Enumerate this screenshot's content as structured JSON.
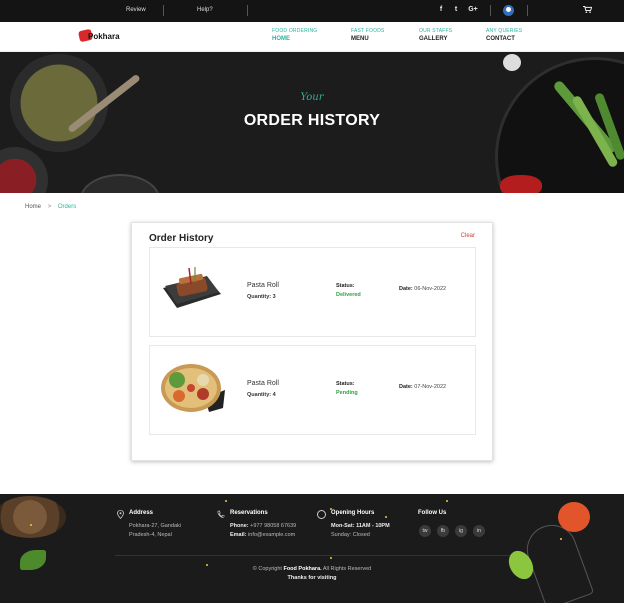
{
  "topbar": {
    "review_label": "Review",
    "help_label": "Help?",
    "social": [
      "f",
      "t",
      "G+"
    ]
  },
  "logo": {
    "text": "Pokhara",
    "badge": "Food"
  },
  "nav": {
    "items": [
      {
        "small": "FOOD ORDERING",
        "big": "HOME"
      },
      {
        "small": "FAST FOODS",
        "big": "MENU"
      },
      {
        "small": "OUR STAFFS",
        "big": "GALLERY"
      },
      {
        "small": "ANY QUERIES",
        "big": "CONTACT"
      }
    ],
    "active_index": 0
  },
  "hero": {
    "subtitle": "Your",
    "title": "ORDER HISTORY"
  },
  "breadcrumb": {
    "home": "Home",
    "current": "Orders"
  },
  "orders_card": {
    "heading": "Order History",
    "clear_label": "Clear",
    "status_label": "Status:",
    "date_label": "Date:",
    "orders": [
      {
        "name": "Pasta Roll",
        "quantity": "Quantity: 3",
        "status": "Delivered",
        "date": "06-Nov-2022"
      },
      {
        "name": "Pasta Roll",
        "quantity": "Quantity: 4",
        "status": "Pending",
        "date": "07-Nov-2022"
      }
    ]
  },
  "footer": {
    "address": {
      "title": "Address",
      "lines": [
        "Pokhara-27, Gandaki",
        "Pradesh-4, Nepal"
      ]
    },
    "reservations": {
      "title": "Reservations",
      "phone_label": "Phone:",
      "phone": "+977 98058 67639",
      "email_label": "Email:",
      "email": "info@example.com"
    },
    "hours": {
      "title": "Opening Hours",
      "weekday_label": "Mon-Sat:",
      "weekday": "11AM - 10PM",
      "sunday": "Sunday: Closed"
    },
    "follow": {
      "title": "Follow Us",
      "icons": [
        "tw",
        "fb",
        "ig",
        "in"
      ]
    },
    "copyright_prefix": "© Copyright",
    "copyright_brand": "Food Pokhara.",
    "copyright_suffix": "All Rights Reserved",
    "thanks": "Thanks for visiting"
  },
  "colors": {
    "accent": "#2bb49c",
    "delivered": "#2ea043",
    "clear": "#d33b3b",
    "dark": "#141414"
  }
}
